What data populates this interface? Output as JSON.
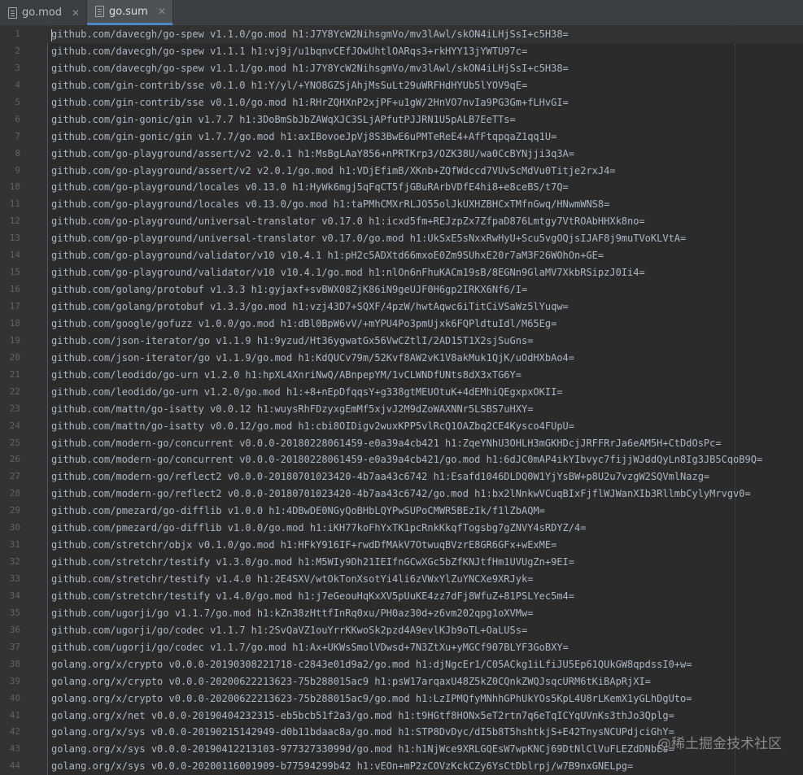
{
  "tabs": [
    {
      "label": "go.mod",
      "active": false
    },
    {
      "label": "go.sum",
      "active": true
    }
  ],
  "lines": [
    {
      "n": "1",
      "text": "github.com/davecgh/go-spew v1.1.0/go.mod h1:J7Y8YcW2NihsgmVo/mv3lAwl/skON4iLHjSsI+c5H38="
    },
    {
      "n": "2",
      "text": "github.com/davecgh/go-spew v1.1.1 h1:vj9j/u1bqnvCEfJOwUhtlOARqs3+rkHYY13jYWTU97c="
    },
    {
      "n": "3",
      "text": "github.com/davecgh/go-spew v1.1.1/go.mod h1:J7Y8YcW2NihsgmVo/mv3lAwl/skON4iLHjSsI+c5H38="
    },
    {
      "n": "4",
      "text": "github.com/gin-contrib/sse v0.1.0 h1:Y/yl/+YNO8GZSjAhjMsSuLt29uWRFHdHYUb5lYOV9qE="
    },
    {
      "n": "5",
      "text": "github.com/gin-contrib/sse v0.1.0/go.mod h1:RHrZQHXnP2xjPF+u1gW/2HnVO7nvIa9PG3Gm+fLHvGI="
    },
    {
      "n": "6",
      "text": "github.com/gin-gonic/gin v1.7.7 h1:3DoBmSbJbZAWqXJC3SLjAPfutPJJRN1U5pALB7EeTTs="
    },
    {
      "n": "7",
      "text": "github.com/gin-gonic/gin v1.7.7/go.mod h1:axIBovoeJpVj8S3BwE6uPMTeReE4+AfFtqpqaZ1qq1U="
    },
    {
      "n": "8",
      "text": "github.com/go-playground/assert/v2 v2.0.1 h1:MsBgLAaY856+nPRTKrp3/OZK38U/wa0CcBYNjji3q3A="
    },
    {
      "n": "9",
      "text": "github.com/go-playground/assert/v2 v2.0.1/go.mod h1:VDjEfimB/XKnb+ZQfWdccd7VUvScMdVu0Titje2rxJ4="
    },
    {
      "n": "10",
      "text": "github.com/go-playground/locales v0.13.0 h1:HyWk6mgj5qFqCT5fjGBuRArbVDfE4hi8+e8ceBS/t7Q="
    },
    {
      "n": "11",
      "text": "github.com/go-playground/locales v0.13.0/go.mod h1:taPMhCMXrRLJO55olJkUXHZBHCxTMfnGwq/HNwmWNS8="
    },
    {
      "n": "12",
      "text": "github.com/go-playground/universal-translator v0.17.0 h1:icxd5fm+REJzpZx7ZfpaD876Lmtgy7VtROAbHHXk8no="
    },
    {
      "n": "13",
      "text": "github.com/go-playground/universal-translator v0.17.0/go.mod h1:UkSxE5sNxxRwHyU+Scu5vgOQjsIJAF8j9muTVoKLVtA="
    },
    {
      "n": "14",
      "text": "github.com/go-playground/validator/v10 v10.4.1 h1:pH2c5ADXtd66mxoE0Zm9SUhxE20r7aM3F26WOhOn+GE="
    },
    {
      "n": "15",
      "text": "github.com/go-playground/validator/v10 v10.4.1/go.mod h1:nlOn6nFhuKACm19sB/8EGNn9GlaMV7XkbRSipzJ0Ii4="
    },
    {
      "n": "16",
      "text": "github.com/golang/protobuf v1.3.3 h1:gyjaxf+svBWX08ZjK86iN9geUJF0H6gp2IRKX6Nf6/I="
    },
    {
      "n": "17",
      "text": "github.com/golang/protobuf v1.3.3/go.mod h1:vzj43D7+SQXF/4pzW/hwtAqwc6iTitCiVSaWz5lYuqw="
    },
    {
      "n": "18",
      "text": "github.com/google/gofuzz v1.0.0/go.mod h1:dBl0BpW6vV/+mYPU4Po3pmUjxk6FQPldtuIdl/M65Eg="
    },
    {
      "n": "19",
      "text": "github.com/json-iterator/go v1.1.9 h1:9yzud/Ht36ygwatGx56VwCZtlI/2AD15T1X2sjSuGns="
    },
    {
      "n": "20",
      "text": "github.com/json-iterator/go v1.1.9/go.mod h1:KdQUCv79m/52Kvf8AW2vK1V8akMuk1QjK/uOdHXbAo4="
    },
    {
      "n": "21",
      "text": "github.com/leodido/go-urn v1.2.0 h1:hpXL4XnriNwQ/ABnpepYM/1vCLWNDfUNts8dX3xTG6Y="
    },
    {
      "n": "22",
      "text": "github.com/leodido/go-urn v1.2.0/go.mod h1:+8+nEpDfqqsY+g338gtMEUOtuK+4dEMhiQEgxpxOKII="
    },
    {
      "n": "23",
      "text": "github.com/mattn/go-isatty v0.0.12 h1:wuysRhFDzyxgEmMf5xjvJ2M9dZoWAXNNr5LSBS7uHXY="
    },
    {
      "n": "24",
      "text": "github.com/mattn/go-isatty v0.0.12/go.mod h1:cbi8OIDigv2wuxKPP5vlRcQ1OAZbq2CE4Kysco4FUpU="
    },
    {
      "n": "25",
      "text": "github.com/modern-go/concurrent v0.0.0-20180228061459-e0a39a4cb421 h1:ZqeYNhU3OHLH3mGKHDcjJRFFRrJa6eAM5H+CtDdOsPc="
    },
    {
      "n": "26",
      "text": "github.com/modern-go/concurrent v0.0.0-20180228061459-e0a39a4cb421/go.mod h1:6dJC0mAP4ikYIbvyc7fijjWJddQyLn8Ig3JB5CqoB9Q="
    },
    {
      "n": "27",
      "text": "github.com/modern-go/reflect2 v0.0.0-20180701023420-4b7aa43c6742 h1:Esafd1046DLDQ0W1YjYsBW+p8U2u7vzgW2SQVmlNazg="
    },
    {
      "n": "28",
      "text": "github.com/modern-go/reflect2 v0.0.0-20180701023420-4b7aa43c6742/go.mod h1:bx2lNnkwVCuqBIxFjflWJWanXIb3RllmbCylyMrvgv0="
    },
    {
      "n": "29",
      "text": "github.com/pmezard/go-difflib v1.0.0 h1:4DBwDE0NGyQoBHbLQYPwSUPoCMWR5BEzIk/f1lZbAQM="
    },
    {
      "n": "30",
      "text": "github.com/pmezard/go-difflib v1.0.0/go.mod h1:iKH77koFhYxTK1pcRnkKkqfTogsbg7gZNVY4sRDYZ/4="
    },
    {
      "n": "31",
      "text": "github.com/stretchr/objx v0.1.0/go.mod h1:HFkY916IF+rwdDfMAkV7OtwuqBVzrE8GR6GFx+wExME="
    },
    {
      "n": "32",
      "text": "github.com/stretchr/testify v1.3.0/go.mod h1:M5WIy9Dh21IEIfnGCwXGc5bZfKNJtfHm1UVUgZn+9EI="
    },
    {
      "n": "33",
      "text": "github.com/stretchr/testify v1.4.0 h1:2E4SXV/wtOkTonXsotYi4li6zVWxYlZuYNCXe9XRJyk="
    },
    {
      "n": "34",
      "text": "github.com/stretchr/testify v1.4.0/go.mod h1:j7eGeouHqKxXV5pUuKE4zz7dFj8WfuZ+81PSLYec5m4="
    },
    {
      "n": "35",
      "text": "github.com/ugorji/go v1.1.7/go.mod h1:kZn38zHttfInRq0xu/PH0az30d+z6vm202qpg1oXVMw="
    },
    {
      "n": "36",
      "text": "github.com/ugorji/go/codec v1.1.7 h1:2SvQaVZ1ouYrrKKwoSk2pzd4A9evlKJb9oTL+OaLUSs="
    },
    {
      "n": "37",
      "text": "github.com/ugorji/go/codec v1.1.7/go.mod h1:Ax+UKWsSmolVDwsd+7N3ZtXu+yMGCf907BLYF3GoBXY="
    },
    {
      "n": "38",
      "text": "golang.org/x/crypto v0.0.0-20190308221718-c2843e01d9a2/go.mod h1:djNgcEr1/C05ACkg1iLfiJU5Ep61QUkGW8qpdssI0+w="
    },
    {
      "n": "39",
      "text": "golang.org/x/crypto v0.0.0-20200622213623-75b288015ac9 h1:psW17arqaxU48Z5kZ0CQnkZWQJsqcURM6tKiBApRjXI="
    },
    {
      "n": "40",
      "text": "golang.org/x/crypto v0.0.0-20200622213623-75b288015ac9/go.mod h1:LzIPMQfyMNhhGPhUkYOs5KpL4U8rLKemX1yGLhDgUto="
    },
    {
      "n": "41",
      "text": "golang.org/x/net v0.0.0-20190404232315-eb5bcb51f2a3/go.mod h1:t9HGtf8HONx5eT2rtn7q6eTqICYqUVnKs3thJo3Qplg="
    },
    {
      "n": "42",
      "text": "golang.org/x/sys v0.0.0-20190215142949-d0b11bdaac8a/go.mod h1:STP8DvDyc/dI5b8T5hshtkjS+E42TnysNCUPdjciGhY="
    },
    {
      "n": "43",
      "text": "golang.org/x/sys v0.0.0-20190412213103-97732733099d/go.mod h1:h1NjWce9XRLGQEsW7wpKNCj69DtNlClVuFLEZdDNbEs="
    },
    {
      "n": "44",
      "text": "golang.org/x/sys v0.0.0-20200116001909-b77594299b42 h1:vEOn+mP2zCOVzKckCZy6YsCtDblrpj/w7B9nxGNELpg="
    }
  ],
  "watermark": "@稀土掘金技术社区"
}
